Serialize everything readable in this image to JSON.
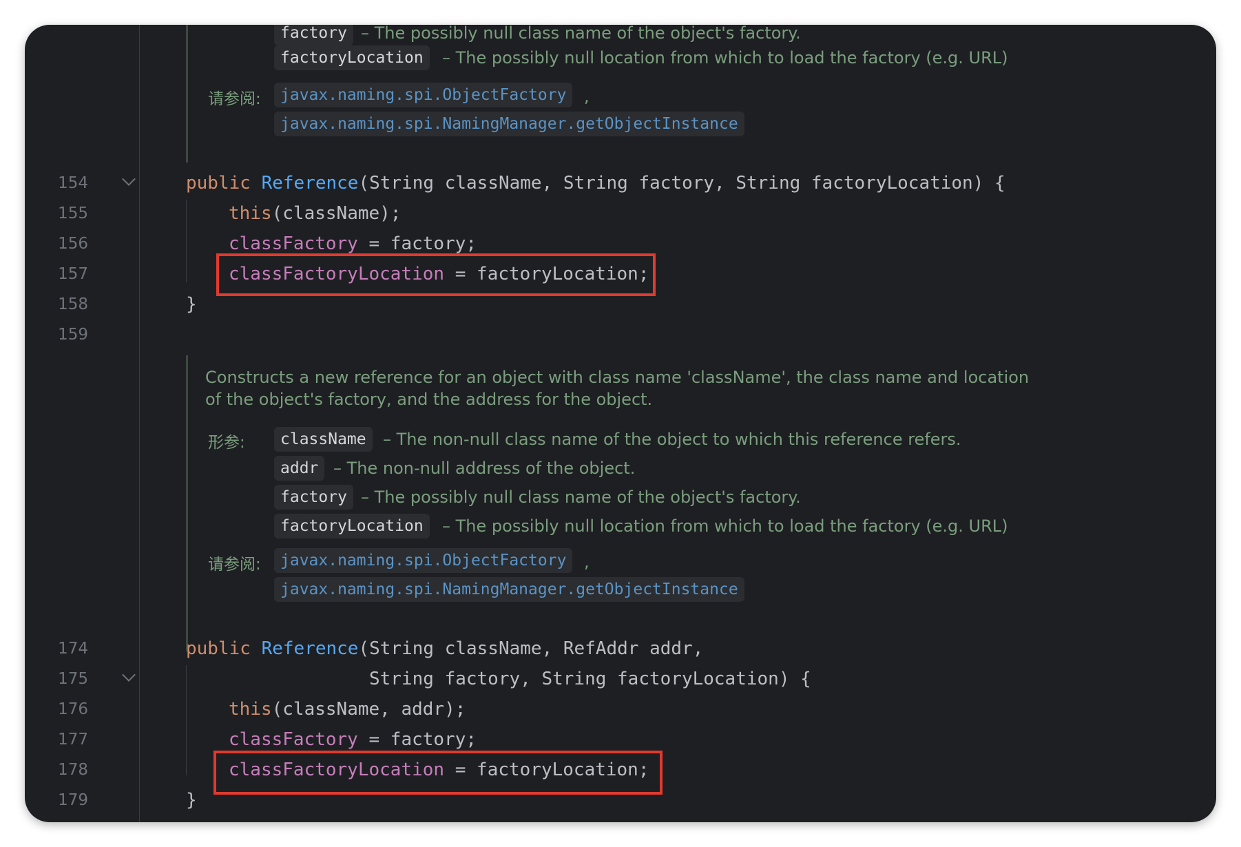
{
  "colors": {
    "background": "#1e1f22",
    "keyword": "#cf8e6d",
    "function": "#56a8f5",
    "field": "#c77dbb",
    "doc_text": "#7a9e7e",
    "link": "#5b93c5",
    "highlight_box": "#e03a2f"
  },
  "doc_top": {
    "params": [
      {
        "name": "factory",
        "desc": "– The possibly null class name of the object's factory."
      },
      {
        "name": "factoryLocation",
        "desc": "– The possibly null location from which to load the factory (e.g. URL)"
      }
    ],
    "see_label": "请参阅:",
    "see_links": [
      "javax.naming.spi.ObjectFactory",
      "javax.naming.spi.NamingManager.getObjectInstance"
    ]
  },
  "code_block_1": {
    "line_numbers": [
      "154",
      "155",
      "156",
      "157",
      "158",
      "159"
    ],
    "sig_kw": "public",
    "sig_fn": "Reference",
    "sig_rest": "(String className, String factory, String factoryLocation) {",
    "l155_kw": "this",
    "l155_rest": "(className);",
    "l156_field": "classFactory",
    "l156_rest": " = factory;",
    "l157_field": "classFactoryLocation",
    "l157_rest": " = factoryLocation;",
    "l158": "}"
  },
  "doc_mid": {
    "description_line1": "Constructs a new reference for an object with class name 'className', the class name and location",
    "description_line2": "of the object's factory, and the address for the object.",
    "params_label": "形参:",
    "params": [
      {
        "name": "className",
        "desc": "– The non-null class name of the object to which this reference refers."
      },
      {
        "name": "addr",
        "desc": "– The non-null address of the object."
      },
      {
        "name": "factory",
        "desc": "– The possibly null class name of the object's factory."
      },
      {
        "name": "factoryLocation",
        "desc": "– The possibly null location from which to load the factory (e.g. URL)"
      }
    ],
    "see_label": "请参阅:",
    "see_links": [
      "javax.naming.spi.ObjectFactory",
      "javax.naming.spi.NamingManager.getObjectInstance"
    ]
  },
  "code_block_2": {
    "line_numbers": [
      "174",
      "175",
      "176",
      "177",
      "178",
      "179"
    ],
    "sig_kw": "public",
    "sig_fn": "Reference",
    "sig_rest": "(String className, RefAddr addr,",
    "l175": "String factory, String factoryLocation) {",
    "l176_kw": "this",
    "l176_rest": "(className, addr);",
    "l177_field": "classFactory",
    "l177_rest": " = factory;",
    "l178_field": "classFactoryLocation",
    "l178_rest": " = factoryLocation;",
    "l179": "}"
  },
  "separator": ","
}
